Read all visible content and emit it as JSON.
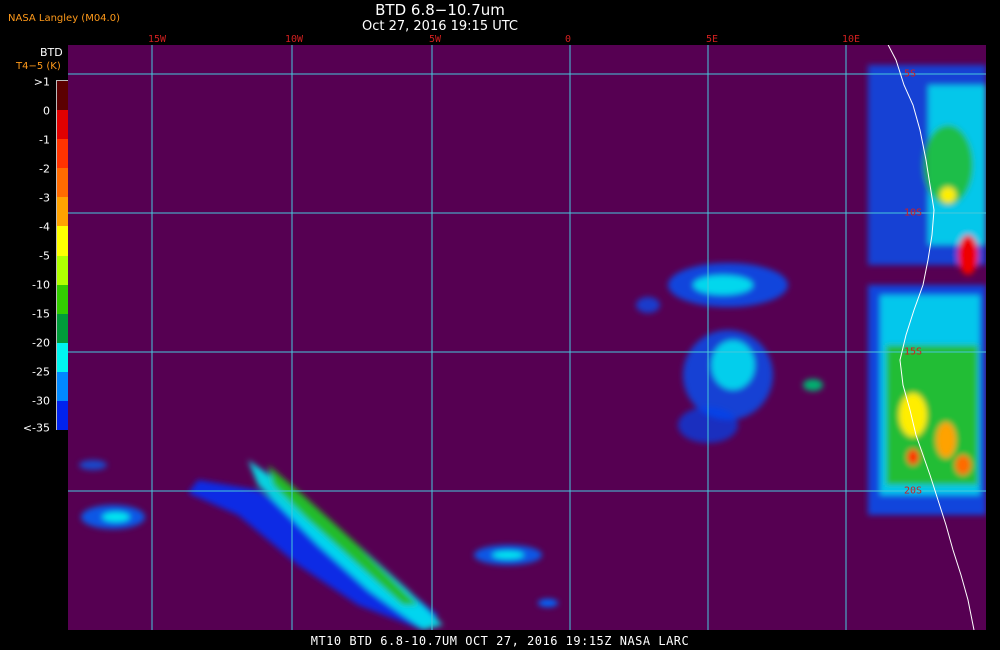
{
  "header": {
    "title": "BTD 6.8−10.7um",
    "subtitle": "Oct 27, 2016 19:15 UTC",
    "source": "NASA Langley (M04.0)"
  },
  "legend": {
    "label": "BTD",
    "unit": "T4−5 (K)",
    "ticks": [
      ">1",
      "0",
      "-1",
      "-2",
      "-3",
      "-4",
      "-5",
      "-10",
      "-15",
      "-20",
      "-25",
      "-30",
      "<-35"
    ],
    "colors": [
      "#5c0000",
      "#e00000",
      "#ff3300",
      "#ff6a00",
      "#ffa200",
      "#ffff00",
      "#b0ff00",
      "#33cc00",
      "#009b3a",
      "#00f5f0",
      "#0088ff",
      "#0022ee",
      "#560052"
    ]
  },
  "map": {
    "background_color": "#560052",
    "grid_color": "#46c8dc",
    "label_color": "#d12020",
    "lon_labels": [
      "15W",
      "10W",
      "5W",
      "0",
      "5E",
      "10E"
    ],
    "lat_labels": [
      "5S",
      "10S",
      "15S",
      "20S"
    ]
  },
  "footer": {
    "caption": "MT10  BTD 6.8-10.7UM   OCT 27, 2016 19:15Z   NASA LARC"
  }
}
